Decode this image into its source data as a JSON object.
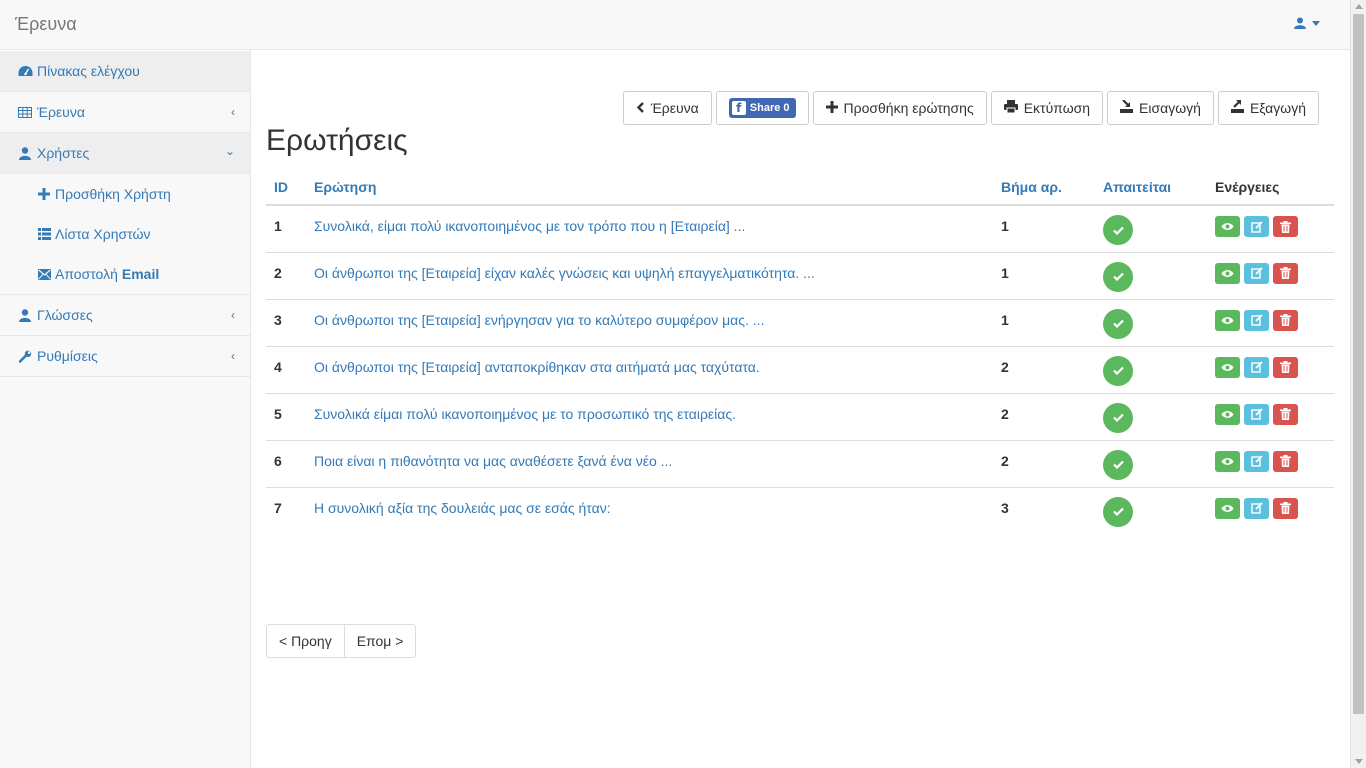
{
  "app": {
    "brand": "Έρευνα"
  },
  "sidebar": {
    "items": [
      {
        "label": "Πίνακας ελέγχου",
        "icon": "dashboard-icon"
      },
      {
        "label": "Έρευνα",
        "icon": "table-icon"
      },
      {
        "label": "Χρήστες",
        "icon": "user-icon"
      },
      {
        "label": "Γλώσσες",
        "icon": "user-icon"
      },
      {
        "label": "Ρυθμίσεις",
        "icon": "wrench-icon"
      }
    ],
    "sub_items": [
      {
        "label": "Προσθήκη Χρήστη",
        "icon": "plus-icon"
      },
      {
        "label": "Λίστα Χρηστών",
        "icon": "list-icon"
      },
      {
        "label": "Αποστολή",
        "bold": "Email",
        "icon": "envelope-icon"
      }
    ]
  },
  "toolbar": {
    "back_label": "Έρευνα",
    "share_label": "Share 0",
    "add_label": "Προσθήκη ερώτησης",
    "print_label": "Εκτύπωση",
    "import_label": "Εισαγωγή",
    "export_label": "Εξαγωγή"
  },
  "page": {
    "title": "Ερωτήσεις"
  },
  "table": {
    "headers": {
      "id": "ID",
      "question": "Ερώτηση",
      "step": "Βήμα αρ.",
      "required": "Απαιτείται",
      "actions": "Ενέργειες"
    },
    "rows": [
      {
        "id": "1",
        "question": "Συνολικά, είμαι πολύ ικανοποιημένος με τον τρόπο που η [Εταιρεία] ...",
        "step": "1"
      },
      {
        "id": "2",
        "question": "Οι άνθρωποι της [Εταιρεία] είχαν καλές γνώσεις και υψηλή επαγγελματικότητα. ...",
        "step": "1"
      },
      {
        "id": "3",
        "question": "Οι άνθρωποι της [Εταιρεία] ενήργησαν για το καλύτερο συμφέρον μας. ...",
        "step": "1"
      },
      {
        "id": "4",
        "question": "Οι άνθρωποι της [Εταιρεία] ανταποκρίθηκαν στα αιτήματά μας ταχύτατα.",
        "step": "2"
      },
      {
        "id": "5",
        "question": "Συνολικά είμαι πολύ ικανοποιημένος με το προσωπικό της εταιρείας.",
        "step": "2"
      },
      {
        "id": "6",
        "question": "Ποια είναι η πιθανότητα να μας αναθέσετε ξανά ένα νέο ...",
        "step": "2"
      },
      {
        "id": "7",
        "question": "Η συνολική αξία της δουλειάς μας σε εσάς ήταν:",
        "step": "3"
      }
    ]
  },
  "pager": {
    "prev": "< Προηγ",
    "next": "Επομ >"
  },
  "colors": {
    "link": "#337ab7",
    "success": "#5cb85c",
    "info": "#5bc0de",
    "danger": "#d9534f"
  }
}
